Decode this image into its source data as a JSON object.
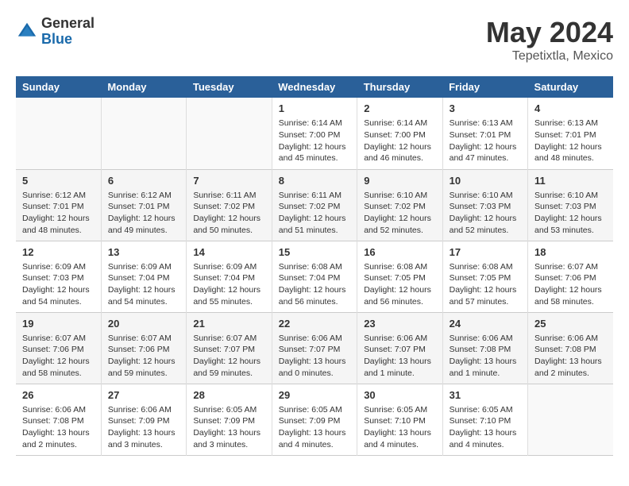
{
  "logo": {
    "general": "General",
    "blue": "Blue"
  },
  "title": "May 2024",
  "subtitle": "Tepetixtla, Mexico",
  "days_of_week": [
    "Sunday",
    "Monday",
    "Tuesday",
    "Wednesday",
    "Thursday",
    "Friday",
    "Saturday"
  ],
  "weeks": [
    [
      {
        "day": "",
        "info": ""
      },
      {
        "day": "",
        "info": ""
      },
      {
        "day": "",
        "info": ""
      },
      {
        "day": "1",
        "info": "Sunrise: 6:14 AM\nSunset: 7:00 PM\nDaylight: 12 hours\nand 45 minutes."
      },
      {
        "day": "2",
        "info": "Sunrise: 6:14 AM\nSunset: 7:00 PM\nDaylight: 12 hours\nand 46 minutes."
      },
      {
        "day": "3",
        "info": "Sunrise: 6:13 AM\nSunset: 7:01 PM\nDaylight: 12 hours\nand 47 minutes."
      },
      {
        "day": "4",
        "info": "Sunrise: 6:13 AM\nSunset: 7:01 PM\nDaylight: 12 hours\nand 48 minutes."
      }
    ],
    [
      {
        "day": "5",
        "info": "Sunrise: 6:12 AM\nSunset: 7:01 PM\nDaylight: 12 hours\nand 48 minutes."
      },
      {
        "day": "6",
        "info": "Sunrise: 6:12 AM\nSunset: 7:01 PM\nDaylight: 12 hours\nand 49 minutes."
      },
      {
        "day": "7",
        "info": "Sunrise: 6:11 AM\nSunset: 7:02 PM\nDaylight: 12 hours\nand 50 minutes."
      },
      {
        "day": "8",
        "info": "Sunrise: 6:11 AM\nSunset: 7:02 PM\nDaylight: 12 hours\nand 51 minutes."
      },
      {
        "day": "9",
        "info": "Sunrise: 6:10 AM\nSunset: 7:02 PM\nDaylight: 12 hours\nand 52 minutes."
      },
      {
        "day": "10",
        "info": "Sunrise: 6:10 AM\nSunset: 7:03 PM\nDaylight: 12 hours\nand 52 minutes."
      },
      {
        "day": "11",
        "info": "Sunrise: 6:10 AM\nSunset: 7:03 PM\nDaylight: 12 hours\nand 53 minutes."
      }
    ],
    [
      {
        "day": "12",
        "info": "Sunrise: 6:09 AM\nSunset: 7:03 PM\nDaylight: 12 hours\nand 54 minutes."
      },
      {
        "day": "13",
        "info": "Sunrise: 6:09 AM\nSunset: 7:04 PM\nDaylight: 12 hours\nand 54 minutes."
      },
      {
        "day": "14",
        "info": "Sunrise: 6:09 AM\nSunset: 7:04 PM\nDaylight: 12 hours\nand 55 minutes."
      },
      {
        "day": "15",
        "info": "Sunrise: 6:08 AM\nSunset: 7:04 PM\nDaylight: 12 hours\nand 56 minutes."
      },
      {
        "day": "16",
        "info": "Sunrise: 6:08 AM\nSunset: 7:05 PM\nDaylight: 12 hours\nand 56 minutes."
      },
      {
        "day": "17",
        "info": "Sunrise: 6:08 AM\nSunset: 7:05 PM\nDaylight: 12 hours\nand 57 minutes."
      },
      {
        "day": "18",
        "info": "Sunrise: 6:07 AM\nSunset: 7:06 PM\nDaylight: 12 hours\nand 58 minutes."
      }
    ],
    [
      {
        "day": "19",
        "info": "Sunrise: 6:07 AM\nSunset: 7:06 PM\nDaylight: 12 hours\nand 58 minutes."
      },
      {
        "day": "20",
        "info": "Sunrise: 6:07 AM\nSunset: 7:06 PM\nDaylight: 12 hours\nand 59 minutes."
      },
      {
        "day": "21",
        "info": "Sunrise: 6:07 AM\nSunset: 7:07 PM\nDaylight: 12 hours\nand 59 minutes."
      },
      {
        "day": "22",
        "info": "Sunrise: 6:06 AM\nSunset: 7:07 PM\nDaylight: 13 hours\nand 0 minutes."
      },
      {
        "day": "23",
        "info": "Sunrise: 6:06 AM\nSunset: 7:07 PM\nDaylight: 13 hours\nand 1 minute."
      },
      {
        "day": "24",
        "info": "Sunrise: 6:06 AM\nSunset: 7:08 PM\nDaylight: 13 hours\nand 1 minute."
      },
      {
        "day": "25",
        "info": "Sunrise: 6:06 AM\nSunset: 7:08 PM\nDaylight: 13 hours\nand 2 minutes."
      }
    ],
    [
      {
        "day": "26",
        "info": "Sunrise: 6:06 AM\nSunset: 7:08 PM\nDaylight: 13 hours\nand 2 minutes."
      },
      {
        "day": "27",
        "info": "Sunrise: 6:06 AM\nSunset: 7:09 PM\nDaylight: 13 hours\nand 3 minutes."
      },
      {
        "day": "28",
        "info": "Sunrise: 6:05 AM\nSunset: 7:09 PM\nDaylight: 13 hours\nand 3 minutes."
      },
      {
        "day": "29",
        "info": "Sunrise: 6:05 AM\nSunset: 7:09 PM\nDaylight: 13 hours\nand 4 minutes."
      },
      {
        "day": "30",
        "info": "Sunrise: 6:05 AM\nSunset: 7:10 PM\nDaylight: 13 hours\nand 4 minutes."
      },
      {
        "day": "31",
        "info": "Sunrise: 6:05 AM\nSunset: 7:10 PM\nDaylight: 13 hours\nand 4 minutes."
      },
      {
        "day": "",
        "info": ""
      }
    ]
  ]
}
